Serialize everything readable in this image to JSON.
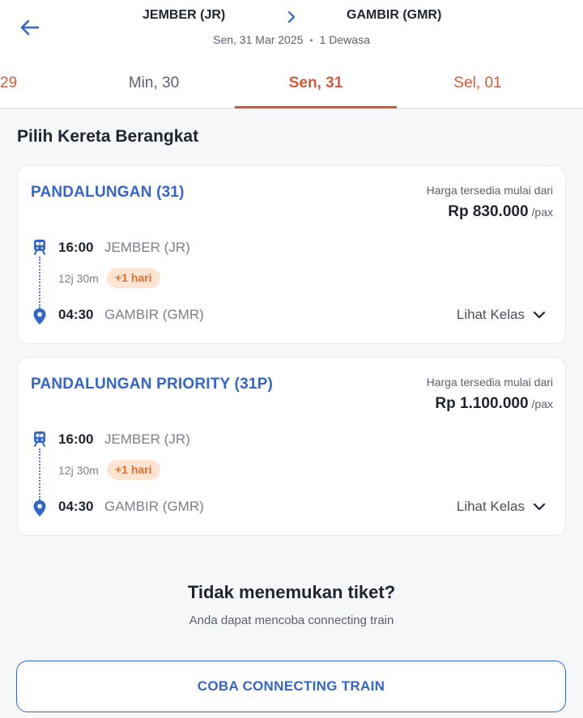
{
  "header": {
    "origin": "JEMBER (JR)",
    "destination": "GAMBIR (GMR)",
    "date": "Sen, 31 Mar 2025",
    "passengers": "1 Dewasa",
    "separator": "•"
  },
  "date_tabs": [
    {
      "label": "29",
      "selected": false
    },
    {
      "label": "Min, 30",
      "selected": false
    },
    {
      "label": "Sen, 31",
      "selected": true
    },
    {
      "label": "Sel, 01",
      "selected": false
    }
  ],
  "section_title": "Pilih Kereta Berangkat",
  "trains": [
    {
      "name": "PANDALUNGAN (31)",
      "price_label": "Harga tersedia mulai dari",
      "price": "Rp 830.000",
      "price_unit": "/pax",
      "dep_time": "16:00",
      "dep_station": "JEMBER (JR)",
      "duration": "12j 30m",
      "day_badge": "+1 hari",
      "arr_time": "04:30",
      "arr_station": "GAMBIR (GMR)",
      "class_link": "Lihat Kelas"
    },
    {
      "name": "PANDALUNGAN PRIORITY (31P)",
      "price_label": "Harga tersedia mulai dari",
      "price": "Rp 1.100.000",
      "price_unit": "/pax",
      "dep_time": "16:00",
      "dep_station": "JEMBER (JR)",
      "duration": "12j 30m",
      "day_badge": "+1 hari",
      "arr_time": "04:30",
      "arr_station": "GAMBIR (GMR)",
      "class_link": "Lihat Kelas"
    }
  ],
  "not_found": {
    "title": "Tidak menemukan tiket?",
    "subtitle": "Anda dapat mencoba connecting train",
    "button": "COBA CONNECTING TRAIN"
  },
  "icons": {
    "back": "arrow-left-icon",
    "route": "chevron-right-icon",
    "train": "train-icon",
    "pin": "location-pin-icon",
    "expand": "chevron-down-icon"
  },
  "colors": {
    "primary": "#3366c9",
    "accent": "#d35b3a",
    "badge_bg": "#fde4d3",
    "badge_text": "#e0702d"
  }
}
